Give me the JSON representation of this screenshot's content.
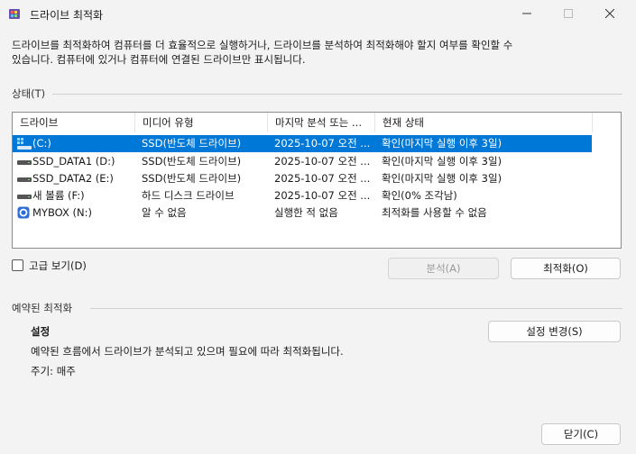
{
  "window": {
    "title": "드라이브 최적화",
    "controls": {
      "minimize": "minimize-icon",
      "maximize": "maximize-icon",
      "close": "close-icon"
    }
  },
  "description": {
    "line1": "드라이브를 최적화하여 컴퓨터를 더 효율적으로 실행하거나, 드라이브를 분석하여 최적화해야 할지 여부를 확인할 수",
    "line2": "있습니다. 컴퓨터에 있거나 컴퓨터에 연결된 드라이브만 표시됩니다."
  },
  "status": {
    "label": "상태(T)",
    "columns": [
      "드라이브",
      "미디어 유형",
      "마지막 분석 또는 ...",
      "현재 상태"
    ],
    "rows": [
      {
        "drive": "(C:)",
        "media": "SSD(반도체 드라이브)",
        "last": "2025-10-07 오전 ...",
        "state": "확인(마지막 실행 이후 3일)",
        "icon": "system-drive-icon",
        "selected": true
      },
      {
        "drive": "SSD_DATA1 (D:)",
        "media": "SSD(반도체 드라이브)",
        "last": "2025-10-07 오전 ...",
        "state": "확인(마지막 실행 이후 3일)",
        "icon": "drive-icon",
        "selected": false
      },
      {
        "drive": "SSD_DATA2 (E:)",
        "media": "SSD(반도체 드라이브)",
        "last": "2025-10-07 오전 ...",
        "state": "확인(마지막 실행 이후 3일)",
        "icon": "drive-icon",
        "selected": false
      },
      {
        "drive": "새 볼륨 (F:)",
        "media": "하드 디스크 드라이브",
        "last": "2025-10-07 오전 ...",
        "state": "확인(0% 조각남)",
        "icon": "drive-icon",
        "selected": false
      },
      {
        "drive": "MYBOX (N:)",
        "media": "알 수 없음",
        "last": "실행한 적 없음",
        "state": "최적화를 사용할 수 없음",
        "icon": "cloud-drive-icon",
        "selected": false
      }
    ]
  },
  "advanced": {
    "label": "고급 보기(D)",
    "checked": false
  },
  "buttons": {
    "analyze": "분석(A)",
    "optimize": "최적화(O)",
    "change_settings": "설정 변경(S)",
    "close": "닫기(C)"
  },
  "scheduled": {
    "label": "예약된 최적화",
    "settings_title": "설정",
    "settings_desc": "예약된 흐름에서 드라이브가 분석되고 있으며 필요에 따라 최적화됩니다.",
    "frequency": "주기: 매주"
  },
  "colors": {
    "selection": "#0078d7",
    "background": "#f3f3f3"
  }
}
